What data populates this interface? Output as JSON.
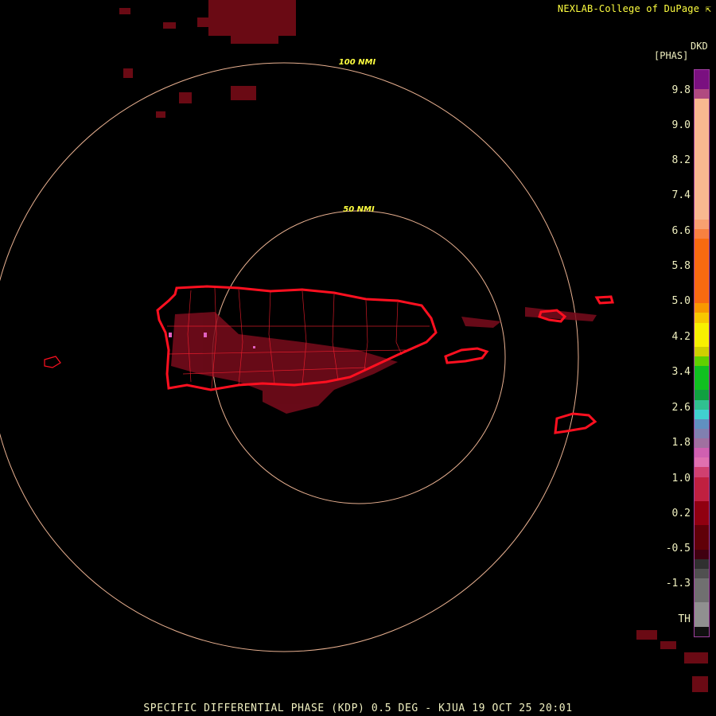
{
  "credit": "NEXLAB-College of DuPage",
  "credit_icon": "arrow-icon",
  "legend": {
    "product": "DKD",
    "unit": "[PHAS]",
    "ticks": [
      "9.8",
      "9.0",
      "8.2",
      "7.4",
      "6.6",
      "5.8",
      "5.0",
      "4.2",
      "3.4",
      "2.6",
      "1.8",
      "1.0",
      "0.2",
      "-0.5",
      "-1.3",
      "TH"
    ]
  },
  "rings": {
    "inner_label": "50 NMI",
    "outer_label": "100 NMI"
  },
  "footer": "SPECIFIC DIFFERENTIAL PHASE (KDP) 0.5 DEG - KJUA 19 OCT 25 20:01",
  "colors": {
    "background": "#000000",
    "ring": "#e8b090",
    "coast": "#ff1020",
    "label": "#ffff40",
    "text": "#f0f0c0"
  }
}
